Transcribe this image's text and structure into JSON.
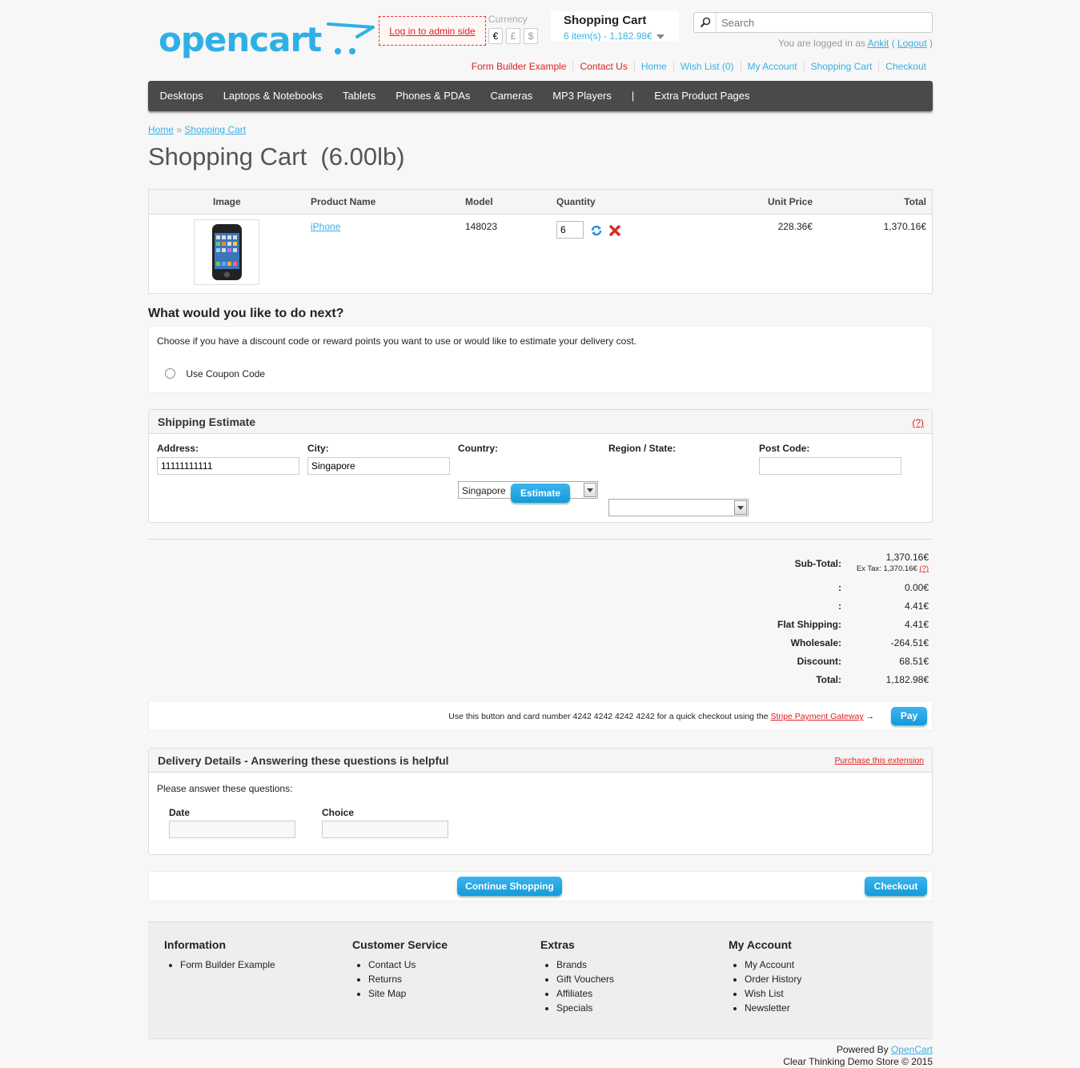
{
  "header": {
    "admin_link": "Log in to admin side",
    "currency_label": "Currency",
    "currencies": [
      "€",
      "£",
      "$"
    ],
    "cart_title": "Shopping Cart",
    "cart_summary": "6 item(s) - 1,182.98€",
    "search_placeholder": "Search",
    "welcome_prefix": "You are logged in as",
    "user_name": "Ankit",
    "logout": "Logout",
    "links": [
      "Form Builder Example",
      "Contact Us",
      "Home",
      "Wish List (0)",
      "My Account",
      "Shopping Cart",
      "Checkout"
    ]
  },
  "menu": [
    "Desktops",
    "Laptops & Notebooks",
    "Tablets",
    "Phones & PDAs",
    "Cameras",
    "MP3 Players",
    "|",
    "Extra Product Pages"
  ],
  "breadcrumb": {
    "home": "Home",
    "sep": "»",
    "current": "Shopping Cart"
  },
  "page_title": "Shopping Cart  (6.00lb)",
  "cart": {
    "columns": {
      "image": "Image",
      "name": "Product Name",
      "model": "Model",
      "quantity": "Quantity",
      "unit_price": "Unit Price",
      "total": "Total"
    },
    "item": {
      "name": "iPhone",
      "model": "148023",
      "quantity": "6",
      "unit_price": "228.36€",
      "total": "1,370.16€"
    }
  },
  "next": {
    "title": "What would you like to do next?",
    "description": "Choose if you have a discount code or reward points you want to use or would like to estimate your delivery cost.",
    "coupon_option": "Use Coupon Code"
  },
  "shipping": {
    "title": "Shipping Estimate",
    "help": "(?)",
    "labels": {
      "address": "Address:",
      "city": "City:",
      "country": "Country:",
      "region": "Region / State:",
      "postcode": "Post Code:"
    },
    "values": {
      "address": "11111111111",
      "city": "Singapore",
      "country": "Singapore",
      "region": "",
      "postcode": ""
    },
    "button": "Estimate"
  },
  "totals": {
    "subtotal_label": "Sub-Total:",
    "subtotal_value": "1,370.16€",
    "ex_tax": "Ex Tax: 1,370.16€",
    "ex_tax_help": "(?)",
    "rows": [
      {
        "label": ":",
        "value": "0.00€"
      },
      {
        "label": ":",
        "value": "4.41€"
      },
      {
        "label": "Flat Shipping:",
        "value": "4.41€"
      },
      {
        "label": "Wholesale:",
        "value": "-264.51€"
      },
      {
        "label": "Discount:",
        "value": "68.51€"
      },
      {
        "label": "Total:",
        "value": "1,182.98€"
      }
    ]
  },
  "stripe": {
    "text": "Use this button and card number 4242 4242 4242 4242 for a quick checkout using the",
    "link": "Stripe Payment Gateway",
    "arrow": "→",
    "button": "Pay"
  },
  "delivery": {
    "title": "Delivery Details - Answering these questions is helpful",
    "purchase_link": "Purchase this extension",
    "prompt": "Please answer these questions:",
    "date_label": "Date",
    "choice_label": "Choice"
  },
  "actions": {
    "continue": "Continue Shopping",
    "checkout": "Checkout"
  },
  "footer": {
    "information": {
      "title": "Information",
      "items": [
        "Form Builder Example"
      ]
    },
    "service": {
      "title": "Customer Service",
      "items": [
        "Contact Us",
        "Returns",
        "Site Map"
      ]
    },
    "extras": {
      "title": "Extras",
      "items": [
        "Brands",
        "Gift Vouchers",
        "Affiliates",
        "Specials"
      ]
    },
    "account": {
      "title": "My Account",
      "items": [
        "My Account",
        "Order History",
        "Wish List",
        "Newsletter"
      ]
    },
    "powered_prefix": "Powered By",
    "powered_link": "OpenCart",
    "copyright": "Clear Thinking Demo Store © 2015"
  },
  "colors": {
    "accent": "#38b0e3",
    "alert": "#e02020",
    "menu_bg": "#4a4a4a",
    "button": "#1aa3e4"
  }
}
